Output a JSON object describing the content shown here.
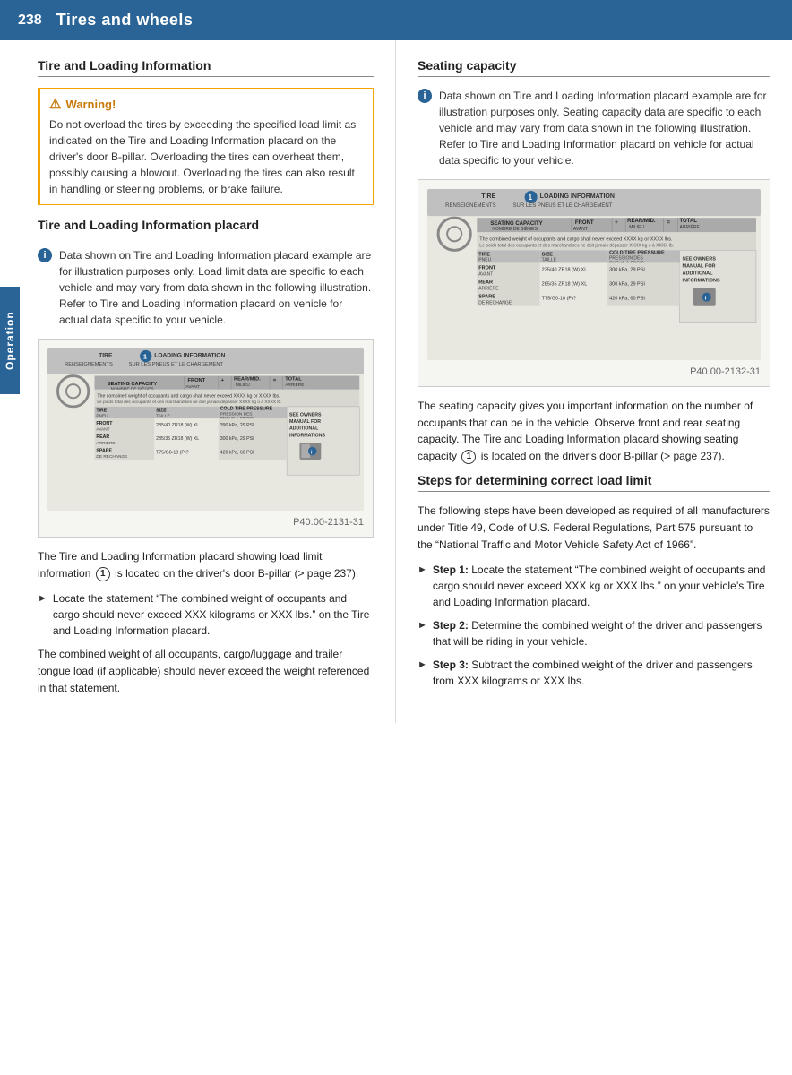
{
  "header": {
    "page_number": "238",
    "title": "Tires and wheels"
  },
  "sidebar": {
    "label": "Operation"
  },
  "left_column": {
    "section1": {
      "heading": "Tire and Loading Information",
      "warning": {
        "title": "Warning!",
        "text": "Do not overload the tires by exceeding the specified load limit as indicated on the Tire and Loading Information placard on the driver's door B-pillar. Overloading the tires can overheat them, possibly causing a blowout. Overloading the tires can also result in handling or steering problems, or brake failure."
      }
    },
    "section2": {
      "heading": "Tire and Loading Information placard",
      "info_note": "Data shown on Tire and Loading Information placard example are for illustration purposes only. Load limit data are specific to each vehicle and may vary from data shown in the following illustration. Refer to Tire and Loading Information placard on vehicle for actual data specific to your vehicle.",
      "placard_caption": "P40.00-2131-31",
      "body_text1": "The Tire and Loading Information placard showing load limit information",
      "body_text1b": "is located on the driver's door B-pillar (> page 237).",
      "bullet1": "Locate the statement “The combined weight of occupants and cargo should never exceed XXX kilograms or XXX lbs.” on the Tire and Loading Information placard.",
      "body_text2": "The combined weight of all occupants, cargo/luggage and trailer tongue load (if applicable) should never exceed the weight referenced in that statement."
    }
  },
  "right_column": {
    "section1": {
      "heading": "Seating capacity",
      "info_note": "Data shown on Tire and Loading Information placard example are for illustration purposes only. Seating capacity data are specific to each vehicle and may vary from data shown in the following illustration. Refer to Tire and Loading Information placard on vehicle for actual data specific to your vehicle.",
      "placard_caption": "P40.00-2132-31",
      "body_text1": "The seating capacity gives you important information on the number of occupants that can be in the vehicle. Observe front and rear seating capacity. The Tire and Loading Information placard showing seating capacity",
      "body_text1b": "is located on the driver's door B-pillar (> page 237)."
    },
    "section2": {
      "heading": "Steps for determining correct load limit",
      "body_text1": "The following steps have been developed as required of all manufacturers under Title 49, Code of U.S. Federal Regulations, Part 575 pursuant to the “National Traffic and Motor Vehicle Safety Act of 1966”.",
      "step1_label": "Step 1:",
      "step1_text": "Locate the statement “The combined weight of occupants and cargo should never exceed XXX kg or XXX lbs.” on your vehicle’s Tire and Loading Information placard.",
      "step2_label": "Step 2:",
      "step2_text": "Determine the combined weight of the driver and passengers that will be riding in your vehicle.",
      "step3_label": "Step 3:",
      "step3_text": "Subtract the combined weight of the driver and passengers from XXX kilograms or XXX lbs."
    }
  }
}
